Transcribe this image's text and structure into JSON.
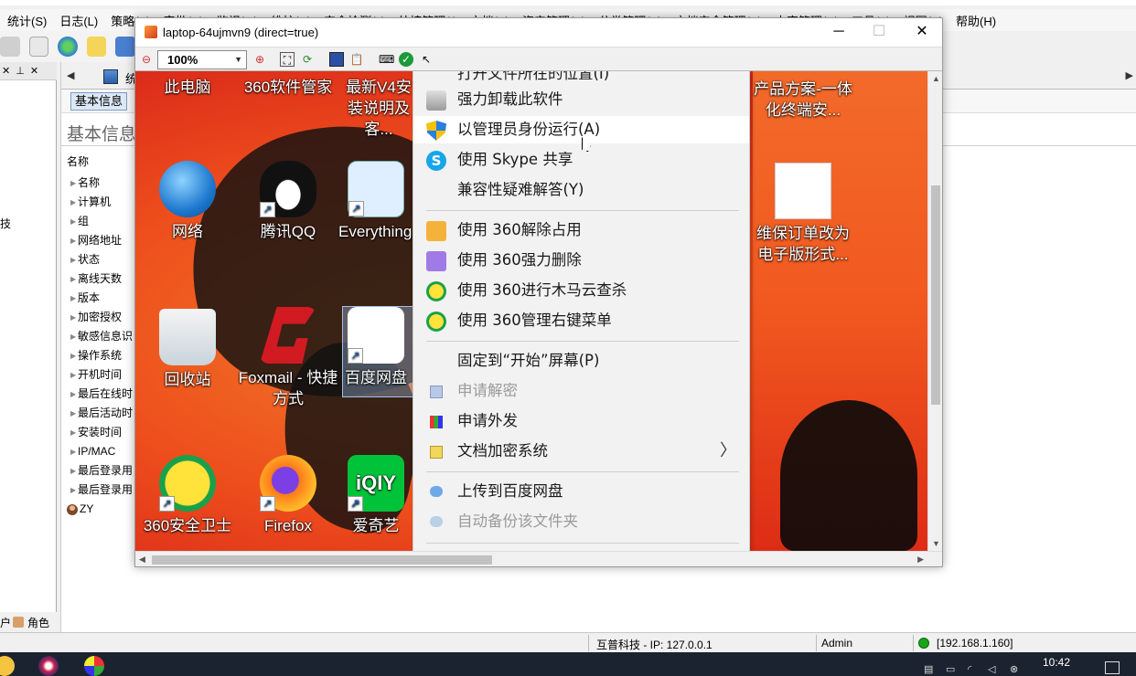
{
  "host": {
    "menu": [
      "统计(S)",
      "日志(L)",
      "策略(P)",
      "审批(R)",
      "监视(M)",
      "维护(N)",
      "安全检测(J)",
      "外接管理(I)",
      "文档(Y)",
      "资产管理(A)",
      "分类管理(B)",
      "文档安全管理(E)",
      "内容管理(C)",
      "工具(T)",
      "视图(V)",
      "帮助(H)"
    ],
    "tab_title": "统",
    "subtab_basic": "基本信息",
    "section_title": "基本信息",
    "tree_header": "名称",
    "tree_items": [
      "名称",
      "计算机",
      "组",
      "网络地址",
      "状态",
      "离线天数",
      "版本",
      "加密授权",
      "敏感信息识",
      "操作系统",
      "开机时间",
      "最后在线时",
      "最后活动时",
      "安装时间",
      "IP/MAC",
      "最后登录用",
      "最后登录用"
    ],
    "tree_user": "ZY",
    "left_side_label": "技",
    "left_tab_1": "户",
    "left_tab_2": "角色",
    "status": {
      "company_ip": "互普科技 - IP: 127.0.0.1",
      "user": "Admin",
      "server": "[192.168.1.160]"
    },
    "clock": "10:42"
  },
  "remote": {
    "title": "laptop-64ujmvn9 (direct=true)",
    "zoom": "100%",
    "desktop_icons": [
      {
        "label": "此电脑",
        "icon": "computer-icon"
      },
      {
        "label": "360软件管家",
        "icon": "360-manager-icon"
      },
      {
        "label": "最新V4安装说明及客...",
        "icon": "document-icon"
      },
      {
        "label": "网络",
        "icon": "network-globe-icon"
      },
      {
        "label": "腾讯QQ",
        "icon": "qq-penguin-icon"
      },
      {
        "label": "Everything - 快捷方式",
        "icon": "everything-search-icon"
      },
      {
        "label": "回收站",
        "icon": "recycle-bin-icon"
      },
      {
        "label": "Foxmail - 快捷方式",
        "icon": "foxmail-icon"
      },
      {
        "label": "百度网盘",
        "icon": "baidu-netdisk-icon"
      },
      {
        "label": "360安全卫士",
        "icon": "360-safe-icon"
      },
      {
        "label": "Firefox",
        "icon": "firefox-icon"
      },
      {
        "label": "爱奇艺",
        "icon": "iqiyi-icon"
      },
      {
        "label": "产品方案-一体化终端安...",
        "icon": "pdf-document-icon"
      },
      {
        "label": "维保订单改为电子版形式...",
        "icon": "scanned-document-icon"
      }
    ],
    "context_menu": {
      "top_cut": "打开文件所在的位置(I)",
      "items": [
        {
          "label": "强力卸载此软件",
          "icon": "trash-can-icon",
          "disabled": false
        },
        {
          "label": "以管理员身份运行(A)",
          "icon": "uac-shield-icon",
          "disabled": false
        },
        {
          "label": "使用 Skype 共享",
          "icon": "skype-icon",
          "disabled": false
        },
        {
          "label": "兼容性疑难解答(Y)",
          "icon": "",
          "disabled": false
        },
        {
          "label": "使用 360解除占用",
          "icon": "360-unlock-icon",
          "disabled": false
        },
        {
          "label": "使用 360强力删除",
          "icon": "360-shred-icon",
          "disabled": false
        },
        {
          "label": "使用 360进行木马云查杀",
          "icon": "360-cloud-scan-icon",
          "disabled": false
        },
        {
          "label": "使用 360管理右键菜单",
          "icon": "360-menu-manage-icon",
          "disabled": false
        },
        {
          "label": "固定到“开始”屏幕(P)",
          "icon": "",
          "disabled": false
        },
        {
          "label": "申请解密",
          "icon": "decrypt-request-icon",
          "disabled": true
        },
        {
          "label": "申请外发",
          "icon": "send-out-request-icon",
          "disabled": false
        },
        {
          "label": "文档加密系统",
          "icon": "doc-encrypt-icon",
          "disabled": false,
          "submenu": true
        },
        {
          "label": "上传到百度网盘",
          "icon": "baidu-cloud-icon",
          "disabled": false
        },
        {
          "label": "自动备份该文件夹",
          "icon": "baidu-backup-icon",
          "disabled": true
        }
      ]
    }
  }
}
